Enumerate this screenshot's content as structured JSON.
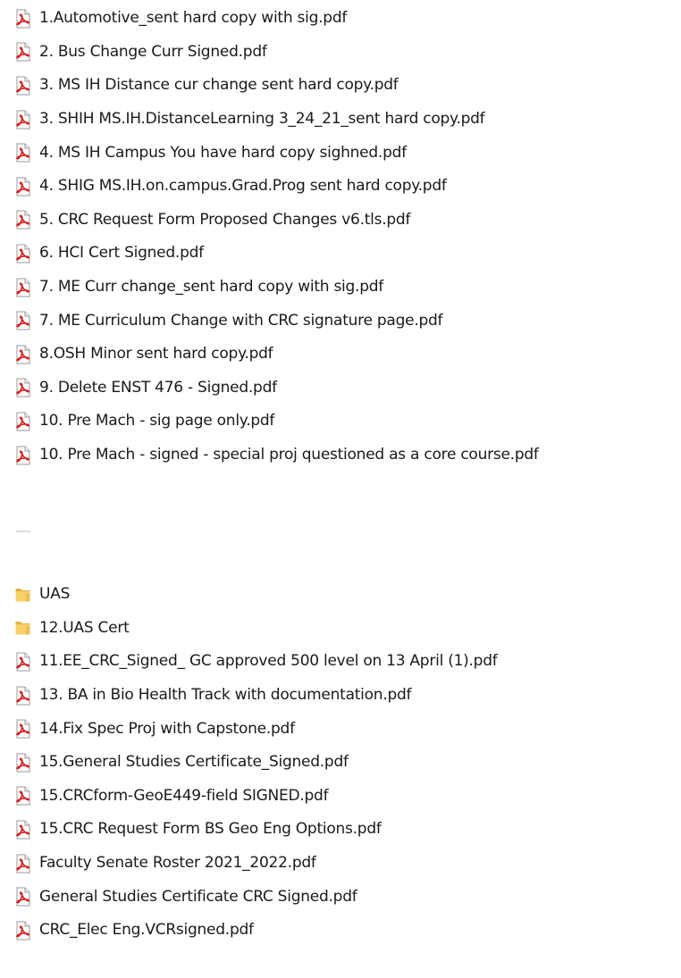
{
  "files_top": [
    {
      "name": "1.Automotive_sent hard copy with sig.pdf",
      "icon": "pdf-icon"
    },
    {
      "name": "2. Bus Change Curr Signed.pdf",
      "icon": "pdf-icon"
    },
    {
      "name": "3. MS IH Distance cur change sent hard copy.pdf",
      "icon": "pdf-icon"
    },
    {
      "name": "3. SHIH MS.IH.DistanceLearning 3_24_21_sent hard copy.pdf",
      "icon": "pdf-icon"
    },
    {
      "name": "4. MS IH Campus You have hard copy sighned.pdf",
      "icon": "pdf-icon"
    },
    {
      "name": "4. SHIG  MS.IH.on.campus.Grad.Prog sent hard copy.pdf",
      "icon": "pdf-icon"
    },
    {
      "name": "5. CRC Request Form Proposed Changes v6.tls.pdf",
      "icon": "pdf-icon"
    },
    {
      "name": "6. HCI Cert Signed.pdf",
      "icon": "pdf-icon"
    },
    {
      "name": "7. ME Curr change_sent hard copy with sig.pdf",
      "icon": "pdf-icon"
    },
    {
      "name": "7. ME Curriculum Change with CRC signature page.pdf",
      "icon": "pdf-icon"
    },
    {
      "name": "8.OSH Minor sent hard copy.pdf",
      "icon": "pdf-icon"
    },
    {
      "name": "9. Delete ENST 476 - Signed.pdf",
      "icon": "pdf-icon"
    },
    {
      "name": "10. Pre Mach - sig page only.pdf",
      "icon": "pdf-icon"
    },
    {
      "name": "10. Pre Mach - signed - special proj questioned as a core course.pdf",
      "icon": "pdf-icon"
    }
  ],
  "files_bottom": [
    {
      "name": "UAS",
      "icon": "folder-icon"
    },
    {
      "name": "12.UAS Cert",
      "icon": "folder-icon"
    },
    {
      "name": "11.EE_CRC_Signed_ GC approved 500  level on 13 April (1).pdf",
      "icon": "pdf-icon"
    },
    {
      "name": "13. BA in Bio Health Track with documentation.pdf",
      "icon": "pdf-icon"
    },
    {
      "name": "14.Fix Spec Proj with Capstone.pdf",
      "icon": "pdf-icon"
    },
    {
      "name": "15.General Studies Certificate_Signed.pdf",
      "icon": "pdf-icon"
    },
    {
      "name": "15.CRCform-GeoE449-field SIGNED.pdf",
      "icon": "pdf-icon"
    },
    {
      "name": "15.CRC Request Form BS Geo Eng Options.pdf",
      "icon": "pdf-icon"
    },
    {
      "name": "Faculty Senate Roster 2021_2022.pdf",
      "icon": "pdf-icon"
    },
    {
      "name": "General Studies Certificate CRC Signed.pdf",
      "icon": "pdf-icon"
    },
    {
      "name": "CRC_Elec Eng.VCRsigned.pdf",
      "icon": "pdf-icon"
    }
  ],
  "colors": {
    "pdf_red": "#d42020",
    "folder_yellow": "#f8d06a",
    "folder_dark": "#e3b341"
  }
}
